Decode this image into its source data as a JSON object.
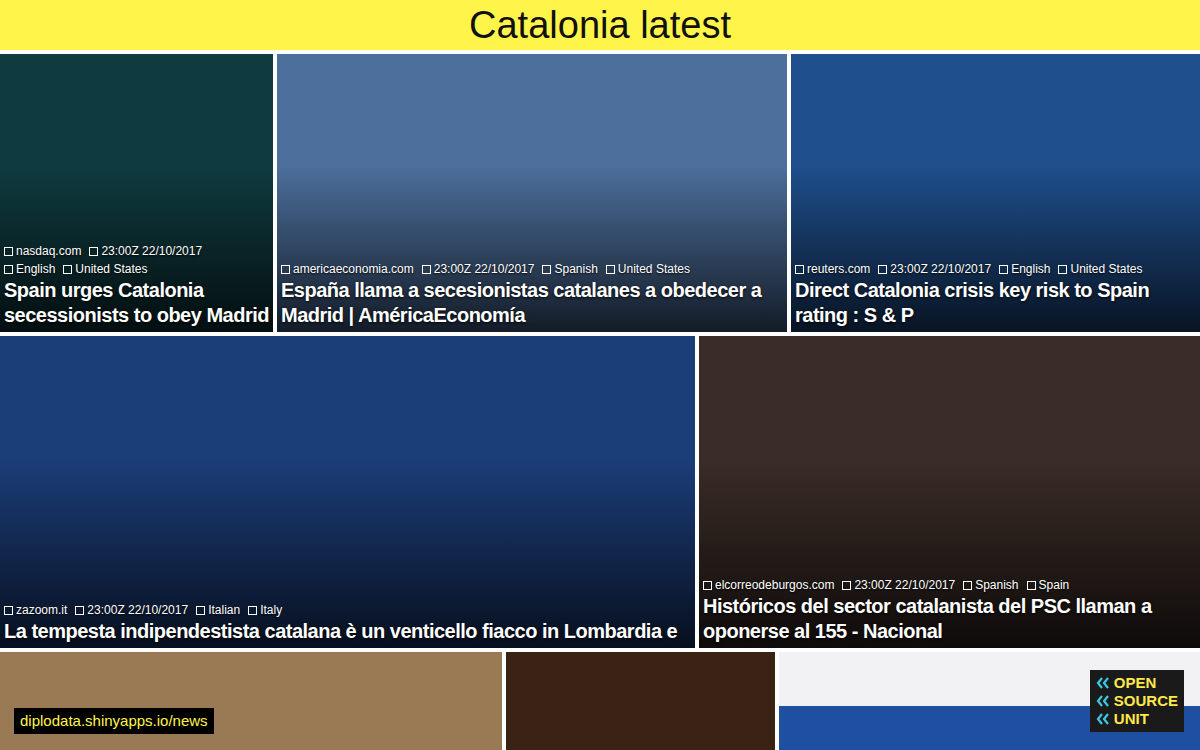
{
  "header": {
    "title": "Catalonia latest"
  },
  "rows": [
    {
      "tiles": [
        {
          "source": "nasdaq.com",
          "time": "23:00Z 22/10/2017",
          "language": "English",
          "country": "United States",
          "title": "Spain urges Catalonia secessionists to obey Madrid",
          "color": "#0f3b40"
        },
        {
          "source": "americaeconomia.com",
          "time": "23:00Z 22/10/2017",
          "language": "Spanish",
          "country": "United States",
          "title": "España llama a secesionistas catalanes a obedecer a Madrid | AméricaEconomía",
          "color": "#4d6f9c"
        },
        {
          "source": "reuters.com",
          "time": "23:00Z 22/10/2017",
          "language": "English",
          "country": "United States",
          "title": "Direct Catalonia crisis key risk to Spain rating : S & P",
          "color": "#1f4f8c"
        }
      ]
    },
    {
      "tiles": [
        {
          "source": "zazoom.it",
          "time": "23:00Z 22/10/2017",
          "language": "Italian",
          "country": "Italy",
          "title": "La tempesta indipendestista catalana è un venticello fiacco in Lombardia e",
          "color": "#1b3d78"
        },
        {
          "source": "elcorreodeburgos.com",
          "time": "23:00Z 22/10/2017",
          "language": "Spanish",
          "country": "Spain",
          "title": "Históricos del sector catalanista del PSC llaman a oponerse al 155 - Nacional",
          "color": "#3a2c27"
        }
      ]
    }
  ],
  "watermark": "diplodata.shinyapps.io/news",
  "logo": {
    "lines": [
      "OPEN",
      "SOURCE",
      "UNIT"
    ]
  }
}
